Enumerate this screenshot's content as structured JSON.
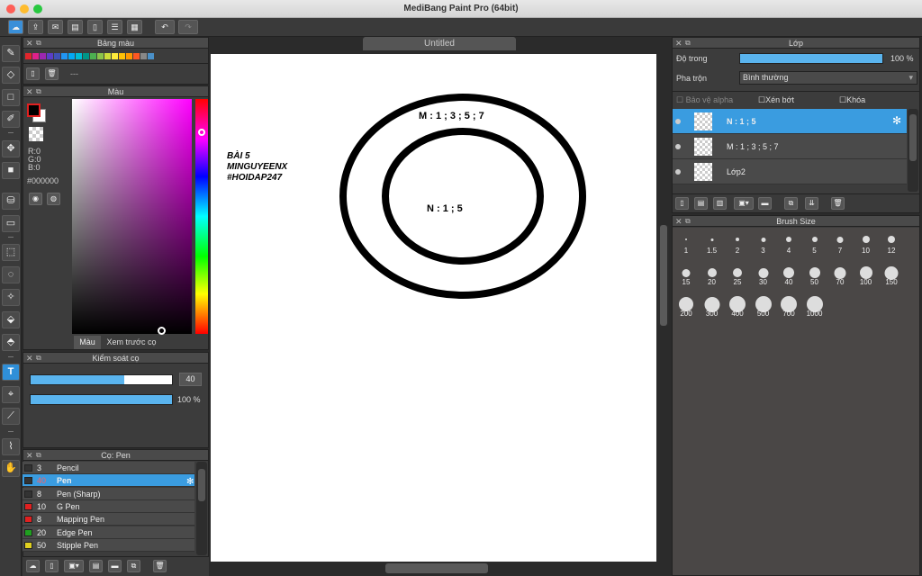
{
  "window": {
    "title": "MediBang Paint Pro (64bit)",
    "colors": {
      "close": "#fe5f57",
      "minimize": "#febc2e",
      "maximize": "#28c840"
    }
  },
  "toolbar": {
    "buttons": [
      "cloud-icon",
      "share-icon",
      "comment-icon",
      "chat-icon",
      "document-icon",
      "checklist-icon",
      "grid-icon"
    ],
    "undo_icon": "undo-icon",
    "redo_icon": "redo-icon"
  },
  "palette_panel": {
    "title": "Bảng màu",
    "swatches": [
      "#e0262c",
      "#e0208a",
      "#9c27b0",
      "#5a3ec8",
      "#3f51b5",
      "#2196f3",
      "#03a9f4",
      "#00bcd4",
      "#009688",
      "#4caf50",
      "#8bc34a",
      "#cddc39",
      "#ffeb3b",
      "#ffc107",
      "#ff9800",
      "#ff5722",
      "#888888",
      "#4a90c8"
    ],
    "dashes": "---"
  },
  "color_panel": {
    "title": "Màu",
    "r": "R:0",
    "g": "G:0",
    "b": "B:0",
    "hex": "#000000",
    "tab_color": "Màu",
    "tab_preview": "Xem trước cọ"
  },
  "brush_control": {
    "title": "Kiểm soát cọ",
    "size_value": "40",
    "size_fraction": 0.66,
    "opacity_value": "100 %",
    "opacity_fraction": 1.0
  },
  "brush_panel": {
    "title": "Cọ: Pen",
    "items": [
      {
        "size": "3",
        "name": "Pencil",
        "color": "#333333"
      },
      {
        "size": "40",
        "name": "Pen",
        "color": "#333333",
        "selected": true
      },
      {
        "size": "8",
        "name": "Pen (Sharp)",
        "color": "#333333"
      },
      {
        "size": "10",
        "name": "G Pen",
        "color": "#e02020"
      },
      {
        "size": "8",
        "name": "Mapping Pen",
        "color": "#e02020"
      },
      {
        "size": "20",
        "name": "Edge Pen",
        "color": "#20a020"
      },
      {
        "size": "50",
        "name": "Stipple Pen",
        "color": "#e0d020"
      }
    ]
  },
  "canvas": {
    "tab_title": "Untitled",
    "text_block": [
      "BÀI 5",
      "MINGUYEENX",
      "#HOIDAP247"
    ],
    "outer_label": "M : 1 ; 3 ; 5 ; 7",
    "inner_label": "N : 1 ; 5"
  },
  "layer_panel": {
    "title": "Lớp",
    "opacity_label": "Độ trong",
    "opacity_value": "100 %",
    "opacity_fraction": 1.0,
    "blend_label": "Pha trộn",
    "blend_value": "Bình thường",
    "protect_alpha": "Bảo vệ alpha",
    "clipping": "Xén bớt",
    "lock": "Khóa",
    "layers": [
      {
        "name": "N : 1 ; 5",
        "selected": true
      },
      {
        "name": "M : 1 ; 3 ; 5 ; 7",
        "selected": false
      },
      {
        "name": "Lớp2",
        "selected": false
      }
    ]
  },
  "brush_size_panel": {
    "title": "Brush Size",
    "sizes": [
      "1",
      "1.5",
      "2",
      "3",
      "4",
      "5",
      "7",
      "10",
      "12",
      "15",
      "20",
      "25",
      "30",
      "40",
      "50",
      "70",
      "100",
      "150",
      "200",
      "300",
      "400",
      "500",
      "700",
      "1000"
    ]
  }
}
